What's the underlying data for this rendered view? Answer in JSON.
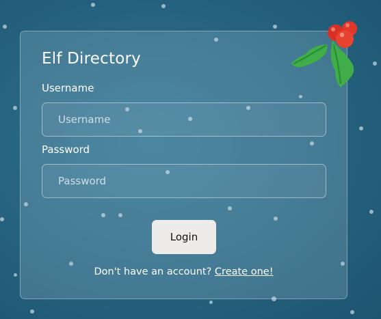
{
  "form": {
    "title": "Elf Directory",
    "username_label": "Username",
    "username_placeholder": "Username",
    "username_value": "",
    "password_label": "Password",
    "password_placeholder": "Password",
    "password_value": "",
    "login_label": "Login",
    "signup_prompt": "Don't have an account?",
    "signup_link": "Create one!"
  },
  "decorations": {
    "corner_icon": "holly-icon",
    "background": "snowfall"
  },
  "colors": {
    "background": "#25627f",
    "button": "#eeecea",
    "holly_leaf": "#3fae49",
    "holly_berry": "#e0372b"
  }
}
